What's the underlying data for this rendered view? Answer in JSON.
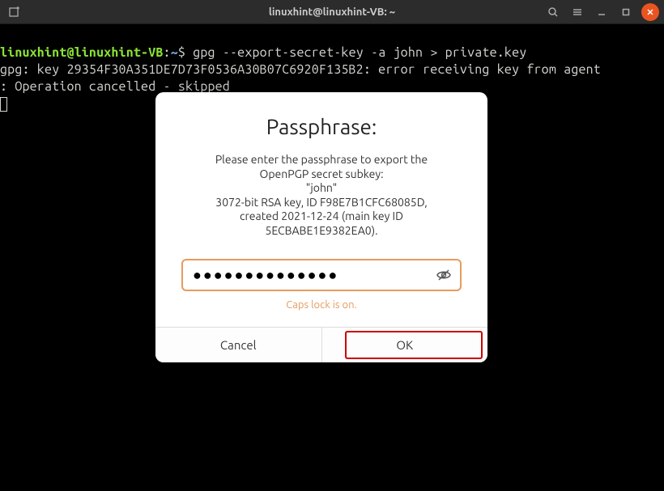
{
  "titlebar": {
    "title": "linuxhint@linuxhint-VB: ~"
  },
  "terminal": {
    "prompt_user": "linuxhint@linuxhint-VB",
    "prompt_sep": ":",
    "prompt_path": "~",
    "prompt_sym": "$ ",
    "command": "gpg --export-secret-key -a john > private.key",
    "line2": "gpg: key 29354F30A351DE7D73F0536A30B07C6920F135B2: error receiving key from agent",
    "line3": ": Operation cancelled - skipped"
  },
  "dialog": {
    "title": "Passphrase:",
    "msg_l1": "Please enter the passphrase to export the",
    "msg_l2": "OpenPGP secret subkey:",
    "msg_l3": "\"john\"",
    "msg_l4": "3072-bit RSA key, ID F98E7B1CFC68085D,",
    "msg_l5": "created 2021-12-24 (main key ID",
    "msg_l6": "5ECBABE1E9382EA0).",
    "pass_value": "●●●●●●●●●●●●●●",
    "caps_warning": "Caps lock is on.",
    "cancel": "Cancel",
    "ok": "OK"
  }
}
